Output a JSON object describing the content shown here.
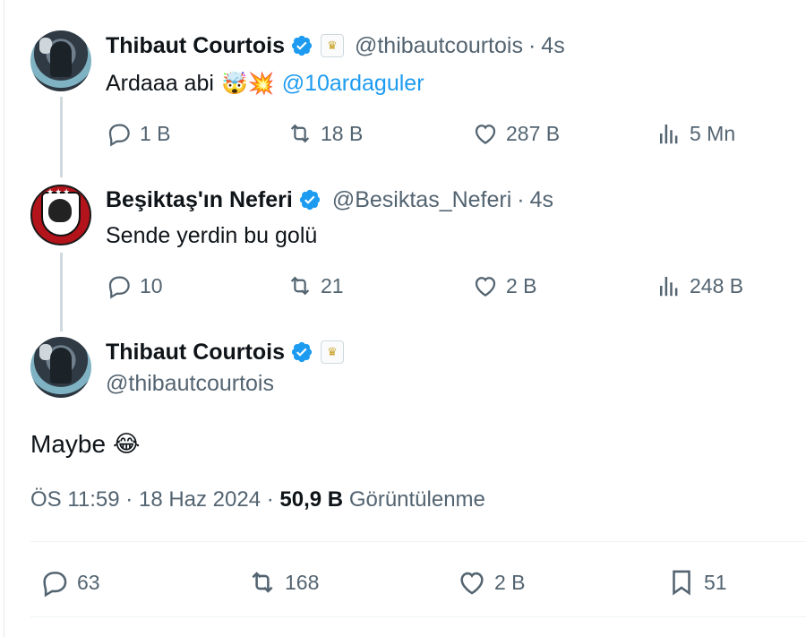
{
  "tweet1": {
    "name": "Thibaut Courtois",
    "handle": "@thibautcourtois",
    "dot": "·",
    "time": "4s",
    "text": "Ardaaa abi",
    "emoji": "🤯💥",
    "mention": "@10ardaguler",
    "actions": {
      "replies": "1 B",
      "retweets": "18 B",
      "likes": "287 B",
      "views": "5 Mn"
    }
  },
  "tweet2": {
    "name": "Beşiktaş'ın Neferi",
    "handle": "@Besiktas_Neferi",
    "dot": "·",
    "time": "4s",
    "text": "Sende yerdin bu golü",
    "actions": {
      "replies": "10",
      "retweets": "21",
      "likes": "2 B",
      "views": "248 B"
    }
  },
  "main": {
    "name": "Thibaut Courtois",
    "handle": "@thibautcourtois",
    "text": "Maybe",
    "emoji": "😂",
    "meta": {
      "time": "ÖS 11:59",
      "sep1": "·",
      "date": "18 Haz 2024",
      "sep2": "·",
      "views_count": "50,9 B",
      "views_label": "Görüntülenme"
    },
    "actions": {
      "replies": "63",
      "retweets": "168",
      "likes": "2 B",
      "bookmarks": "51"
    }
  },
  "colors": {
    "accent": "#1d9bf0",
    "text": "#0f1419",
    "muted": "#536471",
    "thread_line": "#cfd9de"
  },
  "icons": [
    "verified-icon",
    "real-madrid-badge-icon",
    "reply-icon",
    "retweet-icon",
    "like-icon",
    "views-icon",
    "bookmark-icon"
  ]
}
